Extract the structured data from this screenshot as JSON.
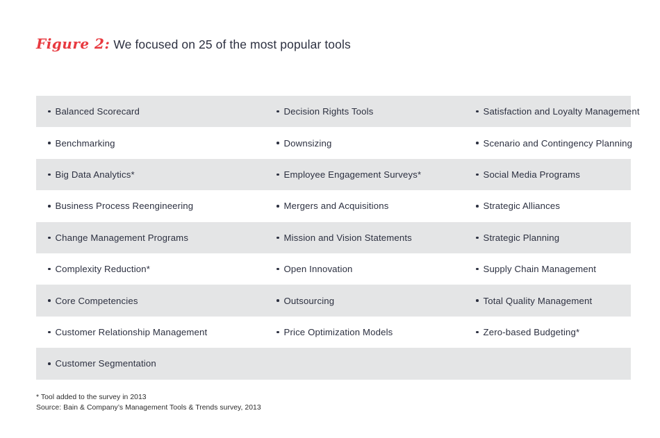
{
  "figure": {
    "label": "Figure 2:",
    "headline": "We focused on 25 of the most popular tools"
  },
  "colors": {
    "accent_red": "#e8393f",
    "text_dark": "#2c3040",
    "row_shaded": "#e4e5e6",
    "row_plain": "#ffffff"
  },
  "table": {
    "rows": [
      {
        "shaded": true,
        "col1": "Balanced Scorecard",
        "col2": "Decision Rights Tools",
        "col3": "Satisfaction and Loyalty Management"
      },
      {
        "shaded": false,
        "col1": "Benchmarking",
        "col2": "Downsizing",
        "col3": "Scenario and Contingency Planning"
      },
      {
        "shaded": true,
        "col1": "Big Data Analytics*",
        "col2": "Employee Engagement Surveys*",
        "col3": "Social Media Programs"
      },
      {
        "shaded": false,
        "col1": "Business Process Reengineering",
        "col2": "Mergers and Acquisitions",
        "col3": "Strategic Alliances"
      },
      {
        "shaded": true,
        "col1": "Change Management Programs",
        "col2": "Mission and Vision Statements",
        "col3": "Strategic Planning"
      },
      {
        "shaded": false,
        "col1": "Complexity Reduction*",
        "col2": "Open Innovation",
        "col3": "Supply Chain Management"
      },
      {
        "shaded": true,
        "col1": "Core Competencies",
        "col2": "Outsourcing",
        "col3": "Total Quality Management"
      },
      {
        "shaded": false,
        "col1": "Customer Relationship Management",
        "col2": "Price Optimization Models",
        "col3": "Zero-based Budgeting*"
      },
      {
        "shaded": true,
        "col1": "Customer Segmentation",
        "col2": "",
        "col3": ""
      }
    ]
  },
  "footnotes": {
    "note": "* Tool added to the survey in 2013",
    "source": "Source: Bain & Company’s Management Tools & Trends survey, 2013"
  }
}
